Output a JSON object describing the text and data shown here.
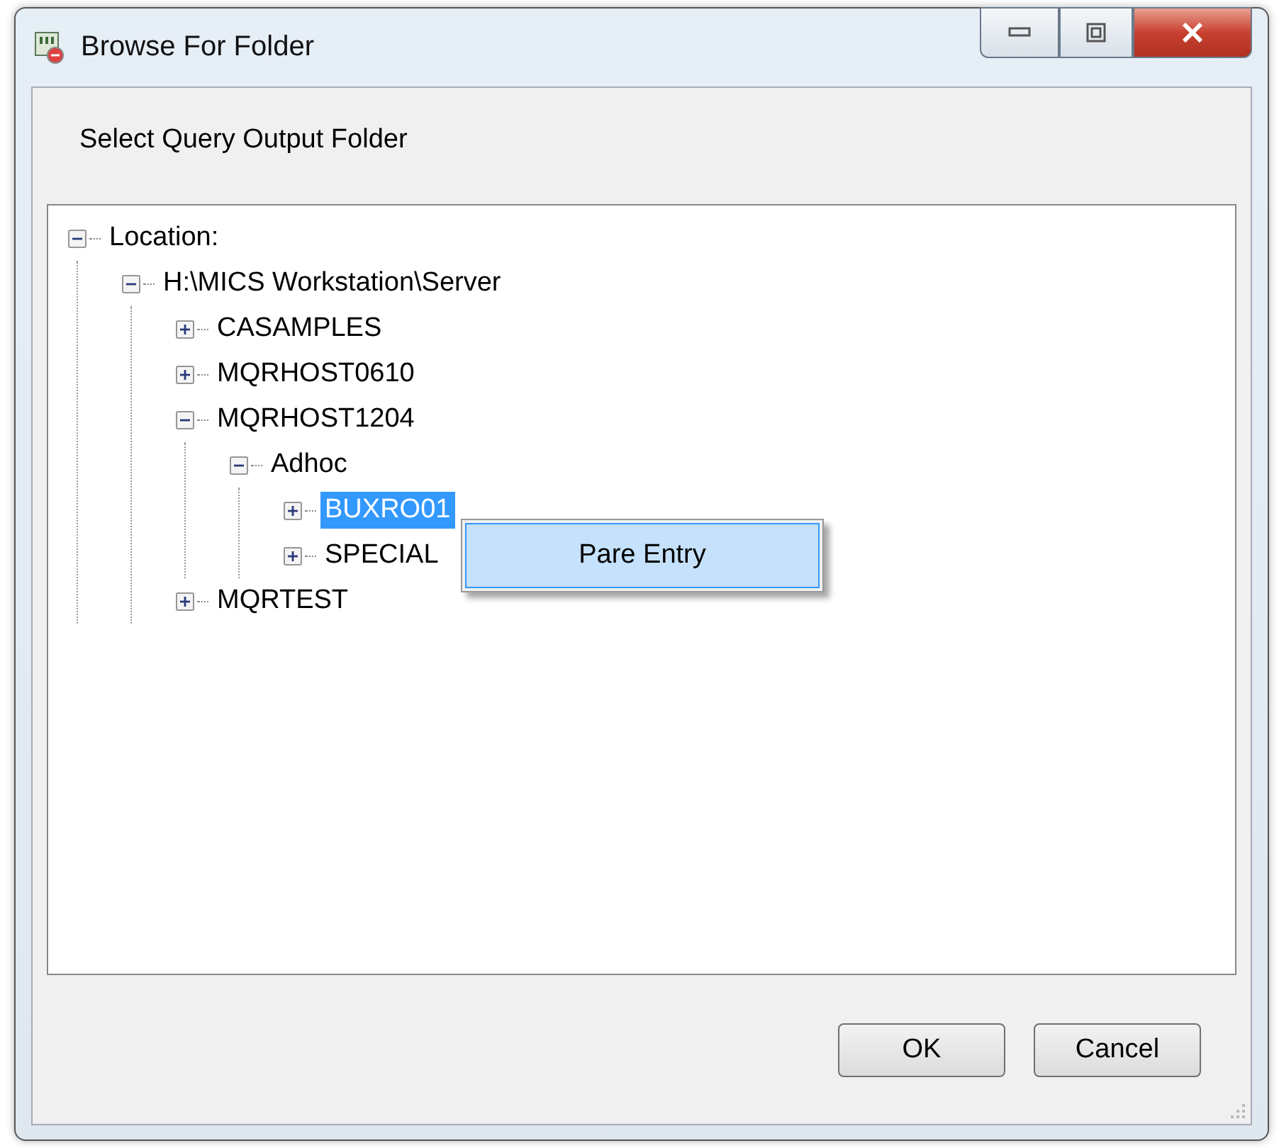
{
  "window": {
    "title": "Browse For Folder"
  },
  "prompt": "Select Query Output Folder",
  "tree": [
    {
      "label": "Location:",
      "expanded": true,
      "selected": false,
      "children": [
        {
          "label": "H:\\MICS Workstation\\Server",
          "expanded": true,
          "selected": false,
          "children": [
            {
              "label": "CASAMPLES",
              "expanded": false,
              "selected": false
            },
            {
              "label": "MQRHOST0610",
              "expanded": false,
              "selected": false
            },
            {
              "label": "MQRHOST1204",
              "expanded": true,
              "selected": false,
              "children": [
                {
                  "label": "Adhoc",
                  "expanded": true,
                  "selected": false,
                  "children": [
                    {
                      "label": "BUXRO01",
                      "expanded": false,
                      "selected": true
                    },
                    {
                      "label": "SPECIAL",
                      "expanded": false,
                      "selected": false
                    }
                  ]
                }
              ]
            },
            {
              "label": "MQRTEST",
              "expanded": false,
              "selected": false
            }
          ]
        }
      ]
    }
  ],
  "context_menu": {
    "items": [
      {
        "label": "Pare Entry",
        "selected": true
      }
    ]
  },
  "buttons": [
    "OK",
    "Cancel"
  ]
}
